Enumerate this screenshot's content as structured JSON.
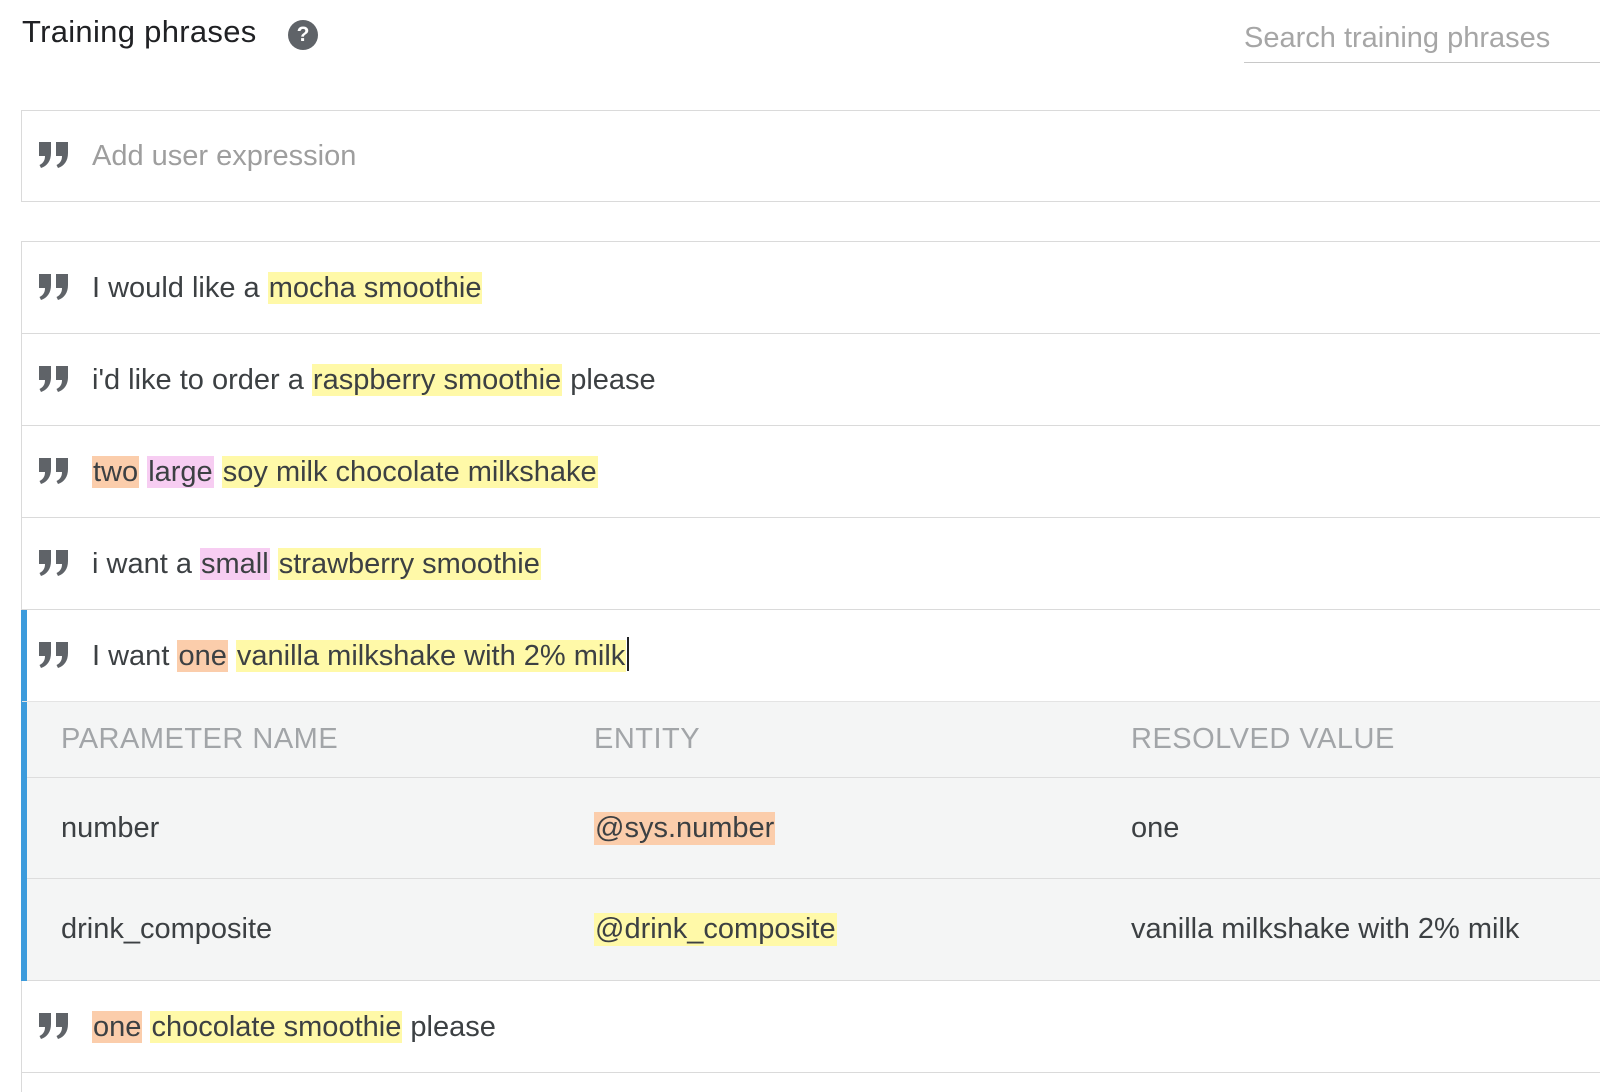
{
  "header": {
    "title": "Training phrases",
    "help_icon": "help-circle-icon",
    "search_placeholder": "Search training phrases"
  },
  "add_expression": {
    "icon": "quote-icon",
    "placeholder": "Add user expression"
  },
  "colors": {
    "highlight_yellow": "#fff9a8",
    "highlight_orange": "#fbcdab",
    "highlight_pink": "#f7cdf2",
    "active_accent": "#3c9bdc"
  },
  "phrases": [
    {
      "segments": [
        {
          "text": "I would like a ",
          "highlight": null
        },
        {
          "text": "mocha smoothie",
          "highlight": "yellow"
        }
      ]
    },
    {
      "segments": [
        {
          "text": "i'd like to order a ",
          "highlight": null
        },
        {
          "text": "raspberry smoothie",
          "highlight": "yellow"
        },
        {
          "text": " please",
          "highlight": null
        }
      ]
    },
    {
      "segments": [
        {
          "text": "two",
          "highlight": "orange"
        },
        {
          "text": " ",
          "highlight": null
        },
        {
          "text": "large",
          "highlight": "pink"
        },
        {
          "text": " ",
          "highlight": null
        },
        {
          "text": "soy milk chocolate milkshake",
          "highlight": "yellow"
        }
      ]
    },
    {
      "segments": [
        {
          "text": "i want a ",
          "highlight": null
        },
        {
          "text": "small",
          "highlight": "pink"
        },
        {
          "text": " ",
          "highlight": null
        },
        {
          "text": "strawberry smoothie",
          "highlight": "yellow"
        }
      ]
    },
    {
      "active": true,
      "segments": [
        {
          "text": "I want ",
          "highlight": null
        },
        {
          "text": "one",
          "highlight": "orange"
        },
        {
          "text": " ",
          "highlight": null
        },
        {
          "text": "vanilla milkshake with 2% milk",
          "highlight": "yellow"
        }
      ]
    },
    {
      "segments": [
        {
          "text": "one",
          "highlight": "orange"
        },
        {
          "text": " ",
          "highlight": null
        },
        {
          "text": "chocolate smoothie",
          "highlight": "yellow"
        },
        {
          "text": " please",
          "highlight": null
        }
      ]
    }
  ],
  "parameter_table": {
    "headers": [
      "PARAMETER NAME",
      "ENTITY",
      "RESOLVED VALUE"
    ],
    "rows": [
      {
        "name": "number",
        "entity": "@sys.number",
        "entity_highlight": "orange",
        "value": "one"
      },
      {
        "name": "drink_composite",
        "entity": "@drink_composite",
        "entity_highlight": "yellow",
        "value": "vanilla milkshake with 2% milk"
      }
    ]
  }
}
